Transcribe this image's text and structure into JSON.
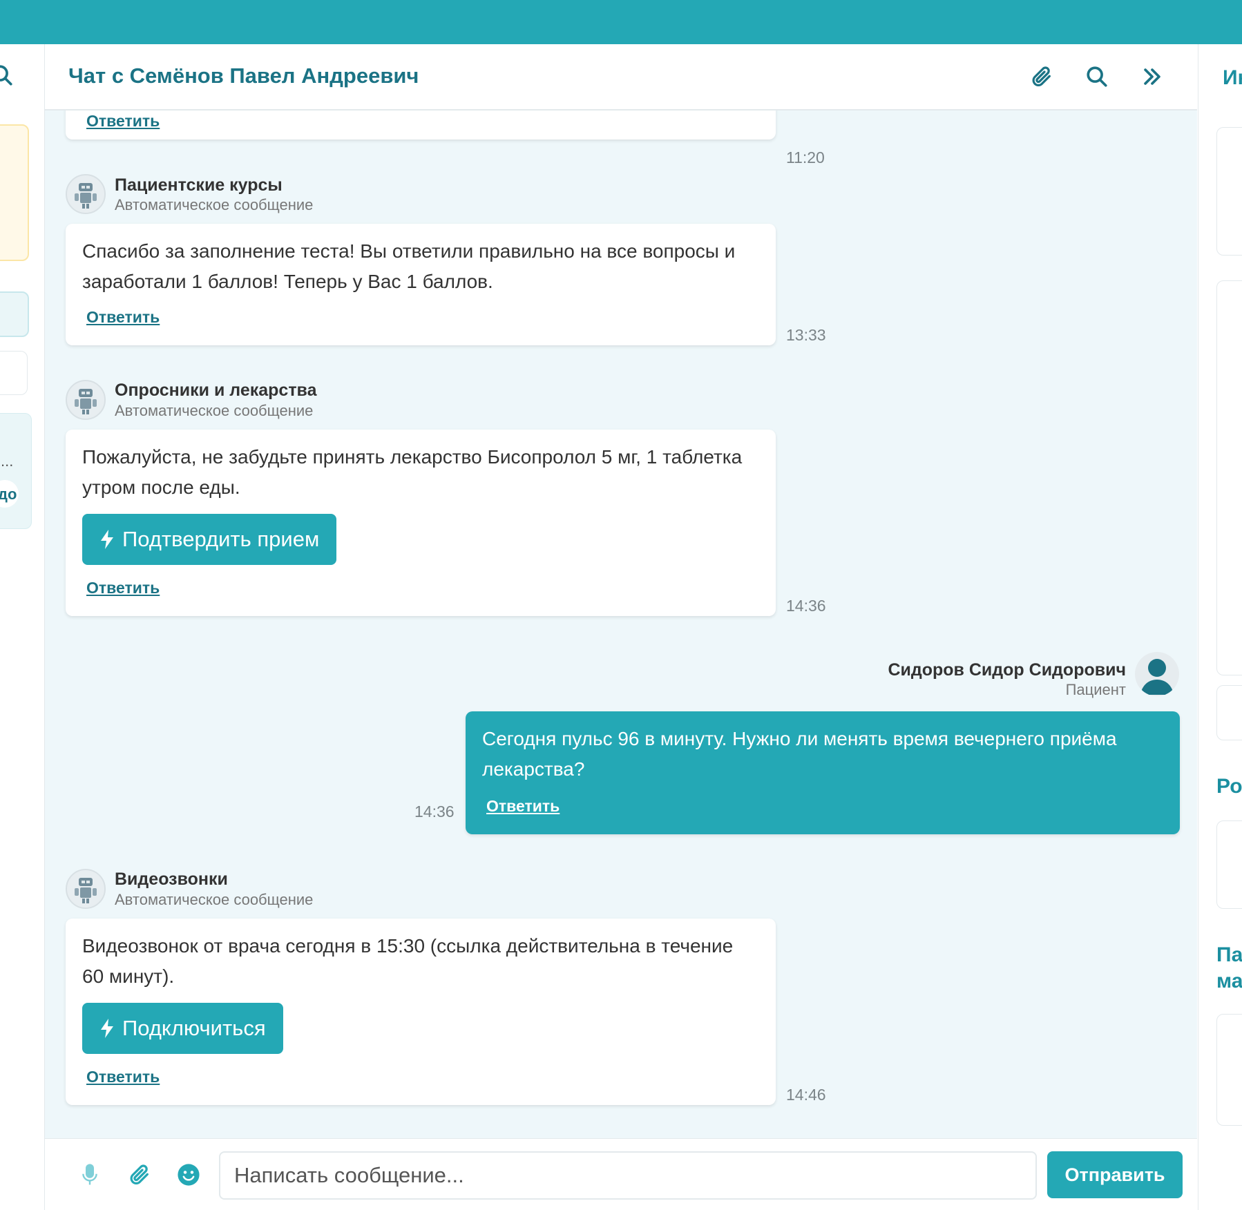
{
  "colors": {
    "accent": "#24a8b5",
    "title": "#1b7385",
    "chat_bg": "#eef7fa"
  },
  "left": {
    "truncated_text_1": "...",
    "truncated_text_2": "до"
  },
  "chat": {
    "title": "Чат с Семёнов Павел Андреевич",
    "header_icons": [
      "paperclip-icon",
      "search-icon",
      "double-chevron-right-icon"
    ],
    "top_partial": {
      "reply": "Ответить",
      "time": "11:20"
    },
    "messages": [
      {
        "sender": "Пациентские курсы",
        "subtitle": "Автоматическое сообщение",
        "text": "Спасибо за заполнение теста! Вы ответили правильно на все вопросы и заработали 1 баллов! Теперь у Вас 1 баллов.",
        "reply": "Ответить",
        "time": "13:33"
      },
      {
        "sender": "Опросники и лекарства",
        "subtitle": "Автоматическое сообщение",
        "text": "Пожалуйста, не забудьте принять лекарство Бисопролол 5 мг, 1 таблетка утром после еды.",
        "button": "Подтвердить прием",
        "reply": "Ответить",
        "time": "14:36"
      },
      {
        "sender": "Сидоров Сидор Сидорович",
        "subtitle": "Пациент",
        "text": "Сегодня пульс 96 в минуту. Нужно ли менять время вечернего приёма лекарства?",
        "reply": "Ответить",
        "time": "14:36"
      },
      {
        "sender": "Видеозвонки",
        "subtitle": "Автоматическое сообщение",
        "text": "Видеозвонок от врача сегодня в 15:30 (ссылка действительна в течение 60 минут).",
        "button": "Подключиться",
        "reply": "Ответить",
        "time": "14:46"
      }
    ],
    "composer": {
      "placeholder": "Написать сообщение...",
      "send": "Отправить",
      "icons": [
        "microphone-icon",
        "paperclip-icon",
        "smiley-icon"
      ]
    }
  },
  "right": {
    "header_partial": "Ин",
    "section_1_partial": "Ро",
    "section_2_partial_line1": "Па",
    "section_2_partial_line2": "ма"
  }
}
